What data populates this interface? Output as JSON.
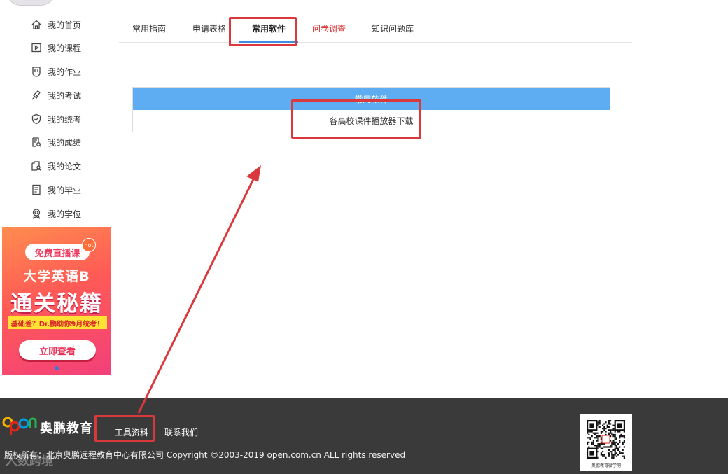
{
  "sidebar": {
    "items": [
      {
        "label": "我的首页",
        "icon": "home-icon"
      },
      {
        "label": "我的课程",
        "icon": "play-icon"
      },
      {
        "label": "我的作业",
        "icon": "assignment-icon"
      },
      {
        "label": "我的考试",
        "icon": "exam-icon"
      },
      {
        "label": "我的统考",
        "icon": "shield-check-icon"
      },
      {
        "label": "我的成绩",
        "icon": "grade-icon"
      },
      {
        "label": "我的论文",
        "icon": "paper-icon"
      },
      {
        "label": "我的毕业",
        "icon": "graduation-icon"
      },
      {
        "label": "我的学位",
        "icon": "medal-icon"
      }
    ]
  },
  "banner": {
    "pill": "免费直播课",
    "hot": "hot",
    "line1": "大学英语B",
    "line2": "通关秘籍",
    "strip": "基础差？Dr.鹏助你9月统考！",
    "cta": "立即查看"
  },
  "tabs": [
    {
      "label": "常用指南"
    },
    {
      "label": "申请表格"
    },
    {
      "label": "常用软件"
    },
    {
      "label": "问卷调查"
    },
    {
      "label": "知识问题库"
    }
  ],
  "table": {
    "header": "常用软件",
    "rows": [
      "各高校课件播放器下载"
    ]
  },
  "footer": {
    "logo_mark": "open",
    "logo_text": "奥鹏教育",
    "links": [
      "工具资料",
      "联系我们"
    ],
    "copyright": "版权所有：北京奥鹏远程教育中心有限公司 Copyright ©2003-2019 open.com.cn ALL rights reserved",
    "qr_caption": "奥鹏教育微学吧",
    "watermark": "人数跨境"
  },
  "colors": {
    "accent": "#5eadf3",
    "annotation": "#d9393b",
    "footer_bg": "#3a3a3a",
    "tab_red": "#d93030"
  }
}
